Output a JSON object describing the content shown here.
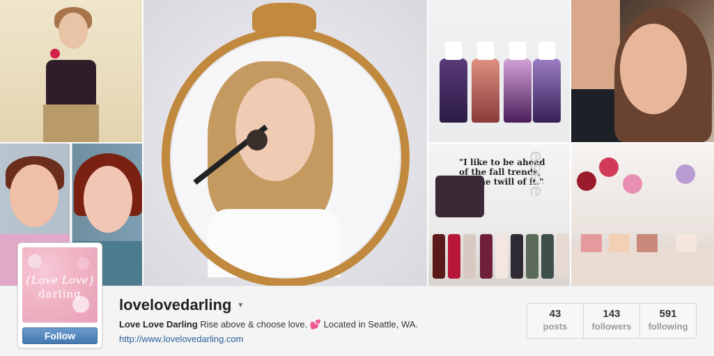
{
  "profile": {
    "username": "lovelovedarling",
    "display_name": "Love Love Darling",
    "bio_text": "Rise above & choose love.",
    "bio_emoji": "💕",
    "location_text": "Located in Seattle, WA.",
    "website": "http://www.lovelovedarling.com",
    "avatar_line1": "{Love Love}",
    "avatar_line2": "darling",
    "follow_label": "Follow",
    "dropdown_icon": "chevron-down-icon"
  },
  "stats": [
    {
      "value": "43",
      "label": "posts"
    },
    {
      "value": "143",
      "label": "followers"
    },
    {
      "value": "591",
      "label": "following"
    }
  ],
  "photos": {
    "essie_quote": "\"I like to be ahead of the fall trends, for the twill of it.\"",
    "essie_brand": "essie"
  },
  "colors": {
    "follow_button": "#4e80b6",
    "link": "#2a5f9a",
    "avatar_pink": "#f1b5c6"
  }
}
